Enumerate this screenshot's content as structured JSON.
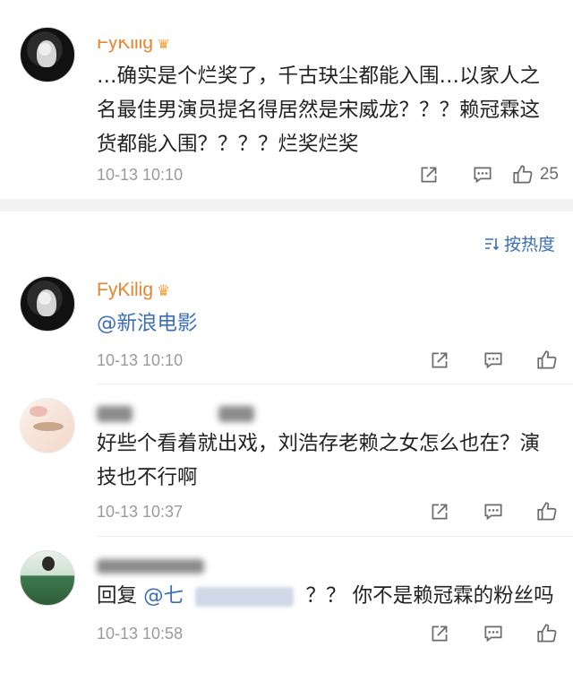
{
  "comments": [
    {
      "username": "FyKilig",
      "content": "…确实是个烂奖了，千古玦尘都能入围…以家人之名最佳男演员提名得居然是宋威龙？？？赖冠霖这货都能入围？？？？烂奖烂奖",
      "time": "10-13 10:10",
      "like_count": "25"
    },
    {
      "username": "FyKilig",
      "mention": "@新浪电影",
      "time": "10-13 10:10"
    },
    {
      "content": "好些个看着就出戏，刘浩存老赖之女怎么也在？演技也不行啊",
      "time": "10-13 10:37"
    },
    {
      "reply_prefix": "回复",
      "mention": "@七",
      "content": "？？ 你不是赖冠霖的粉丝吗",
      "time": "10-13 10:58"
    }
  ],
  "sort": {
    "label": "按热度"
  },
  "icons": {
    "share": "share-icon",
    "comment": "comment-icon",
    "like": "thumbs-up-icon",
    "sort": "sort-icon",
    "crown": "crown-badge-icon"
  },
  "colors": {
    "username": "#e8842f",
    "link": "#3b6eb5",
    "meta": "#9a9a9a"
  }
}
